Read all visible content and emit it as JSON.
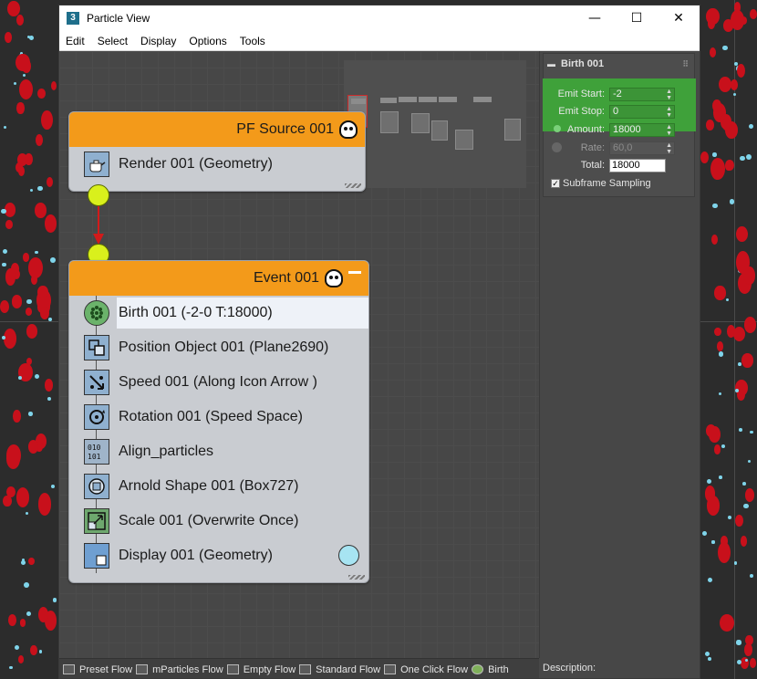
{
  "window": {
    "title": "Particle View",
    "app_icon": "3"
  },
  "window_controls": {
    "minimize": "—",
    "maximize": "☐",
    "close": "✕"
  },
  "menu": [
    "Edit",
    "Select",
    "Display",
    "Options",
    "Tools"
  ],
  "source_node": {
    "title": "PF Source 001",
    "operators": [
      {
        "label": "Render 001 (Geometry)",
        "icon": "teapot-icon"
      }
    ]
  },
  "event_node": {
    "title": "Event 001",
    "operators": [
      {
        "label": "Birth 001 (-2-0 T:18000)",
        "icon": "birth-icon",
        "selected": true
      },
      {
        "label": "Position Object 001 (Plane2690)",
        "icon": "position-object-icon"
      },
      {
        "label": "Speed 001 (Along Icon Arrow )",
        "icon": "speed-icon"
      },
      {
        "label": "Rotation 001 (Speed Space)",
        "icon": "rotation-icon"
      },
      {
        "label": "Align_particles",
        "icon": "script-icon"
      },
      {
        "label": "Arnold Shape 001 (Box727)",
        "icon": "shape-icon"
      },
      {
        "label": "Scale 001 (Overwrite Once)",
        "icon": "scale-icon"
      },
      {
        "label": "Display 001 (Geometry)",
        "icon": "display-icon"
      }
    ]
  },
  "birth_panel": {
    "title": "Birth 001",
    "emit_start_label": "Emit Start:",
    "emit_start_value": "-2",
    "emit_stop_label": "Emit Stop:",
    "emit_stop_value": "0",
    "amount_label": "Amount:",
    "amount_value": "18000",
    "rate_label": "Rate:",
    "rate_value": "60,0",
    "total_label": "Total:",
    "total_value": "18000",
    "subframe_label": "Subframe Sampling",
    "subframe_checked": true
  },
  "depot": [
    "Preset Flow",
    "mParticles Flow",
    "Empty Flow",
    "Standard Flow",
    "One Click Flow",
    "Birth"
  ],
  "description_label": "Description:",
  "colors": {
    "node_header": "#f39a1a",
    "port": "#d9f01c",
    "wire": "#d31a1a",
    "parameter_highlight": "#3fa13a",
    "particle_red": "#c8101b",
    "particle_cyan": "#7fd4ea"
  }
}
